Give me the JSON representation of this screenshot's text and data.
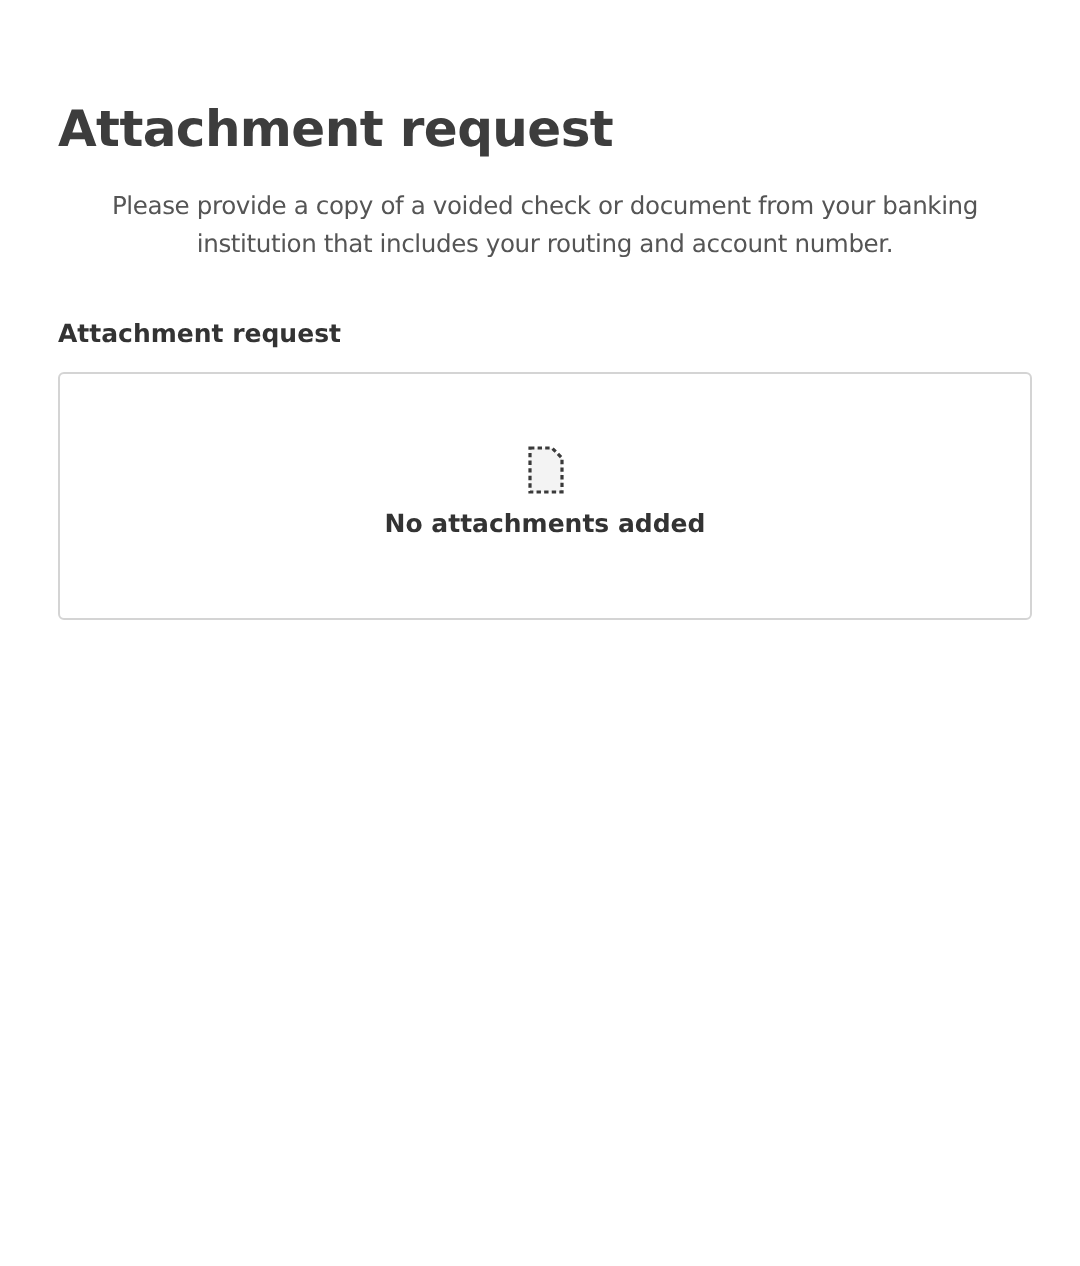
{
  "title": "Attachment request",
  "description": "Please provide a copy of a voided check or document from your banking institution that includes your routing and account number.",
  "section_label": "Attachment request",
  "attachments": {
    "empty_text": "No attachments added"
  }
}
